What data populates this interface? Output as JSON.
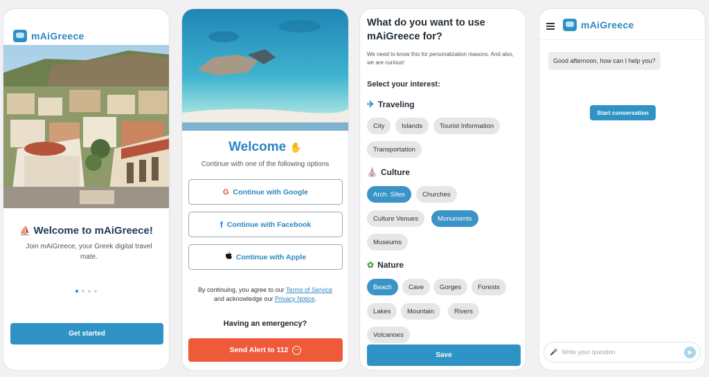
{
  "brand": {
    "name": "mAiGreece",
    "accent": "#2b87c2",
    "alert_color": "#ee5a3a"
  },
  "screen1": {
    "title": "Welcome to mAiGreece!",
    "title_icon": "sailboat-icon",
    "subtitle": "Join mAiGreece,  your Greek digital travel mate.",
    "page_indicator": {
      "count": 4,
      "active": 1
    },
    "cta": "Get started"
  },
  "screen2": {
    "title": "Welcome",
    "title_icon": "waving-hand-icon",
    "subtitle": "Continue with one of the following options",
    "google": "Continue with Google",
    "facebook": "Continue with Facebook",
    "apple": "Continue with Apple",
    "terms_prefix": "By continuing, you agree to our",
    "terms_link": "Terms of Service",
    "terms_mid": "and acknowledge our",
    "privacy_link": "Privacy Notice",
    "emergency_heading": "Having an emergency?",
    "alert_button": "Send Alert to 112"
  },
  "screen3": {
    "title": "What do you want to use mAiGreece for?",
    "subtitle": "We need to know this for personalization reasons. And also, we are curious!",
    "select_label": "Select your interest:",
    "categories": [
      {
        "name": "Traveling",
        "icon": "airplane-icon",
        "chips": [
          {
            "label": "City",
            "selected": false
          },
          {
            "label": "Islands",
            "selected": false
          },
          {
            "label": "Tourist Information",
            "selected": false
          },
          {
            "label": "Transportation",
            "selected": false
          }
        ]
      },
      {
        "name": "Culture",
        "icon": "classical-building-icon",
        "chips": [
          {
            "label": "Arch. Sites",
            "selected": true
          },
          {
            "label": "Churches",
            "selected": false
          },
          {
            "label": "Culture Venues",
            "selected": false
          },
          {
            "label": "Monuments",
            "selected": true
          },
          {
            "label": "Museums",
            "selected": false
          }
        ]
      },
      {
        "name": "Nature",
        "icon": "seedling-icon",
        "chips": [
          {
            "label": "Beach",
            "selected": true
          },
          {
            "label": "Cave",
            "selected": false
          },
          {
            "label": "Gorges",
            "selected": false
          },
          {
            "label": "Forests",
            "selected": false
          },
          {
            "label": "Lakes",
            "selected": false
          },
          {
            "label": "Mountain",
            "selected": false
          },
          {
            "label": "Rivers",
            "selected": false
          },
          {
            "label": "Volcanoes",
            "selected": false
          }
        ]
      }
    ],
    "save_button": "Save"
  },
  "screen4": {
    "greeting": "Good afternoon, how can I help you?",
    "start_button": "Start conversation",
    "input_placeholder": "Write your question"
  }
}
